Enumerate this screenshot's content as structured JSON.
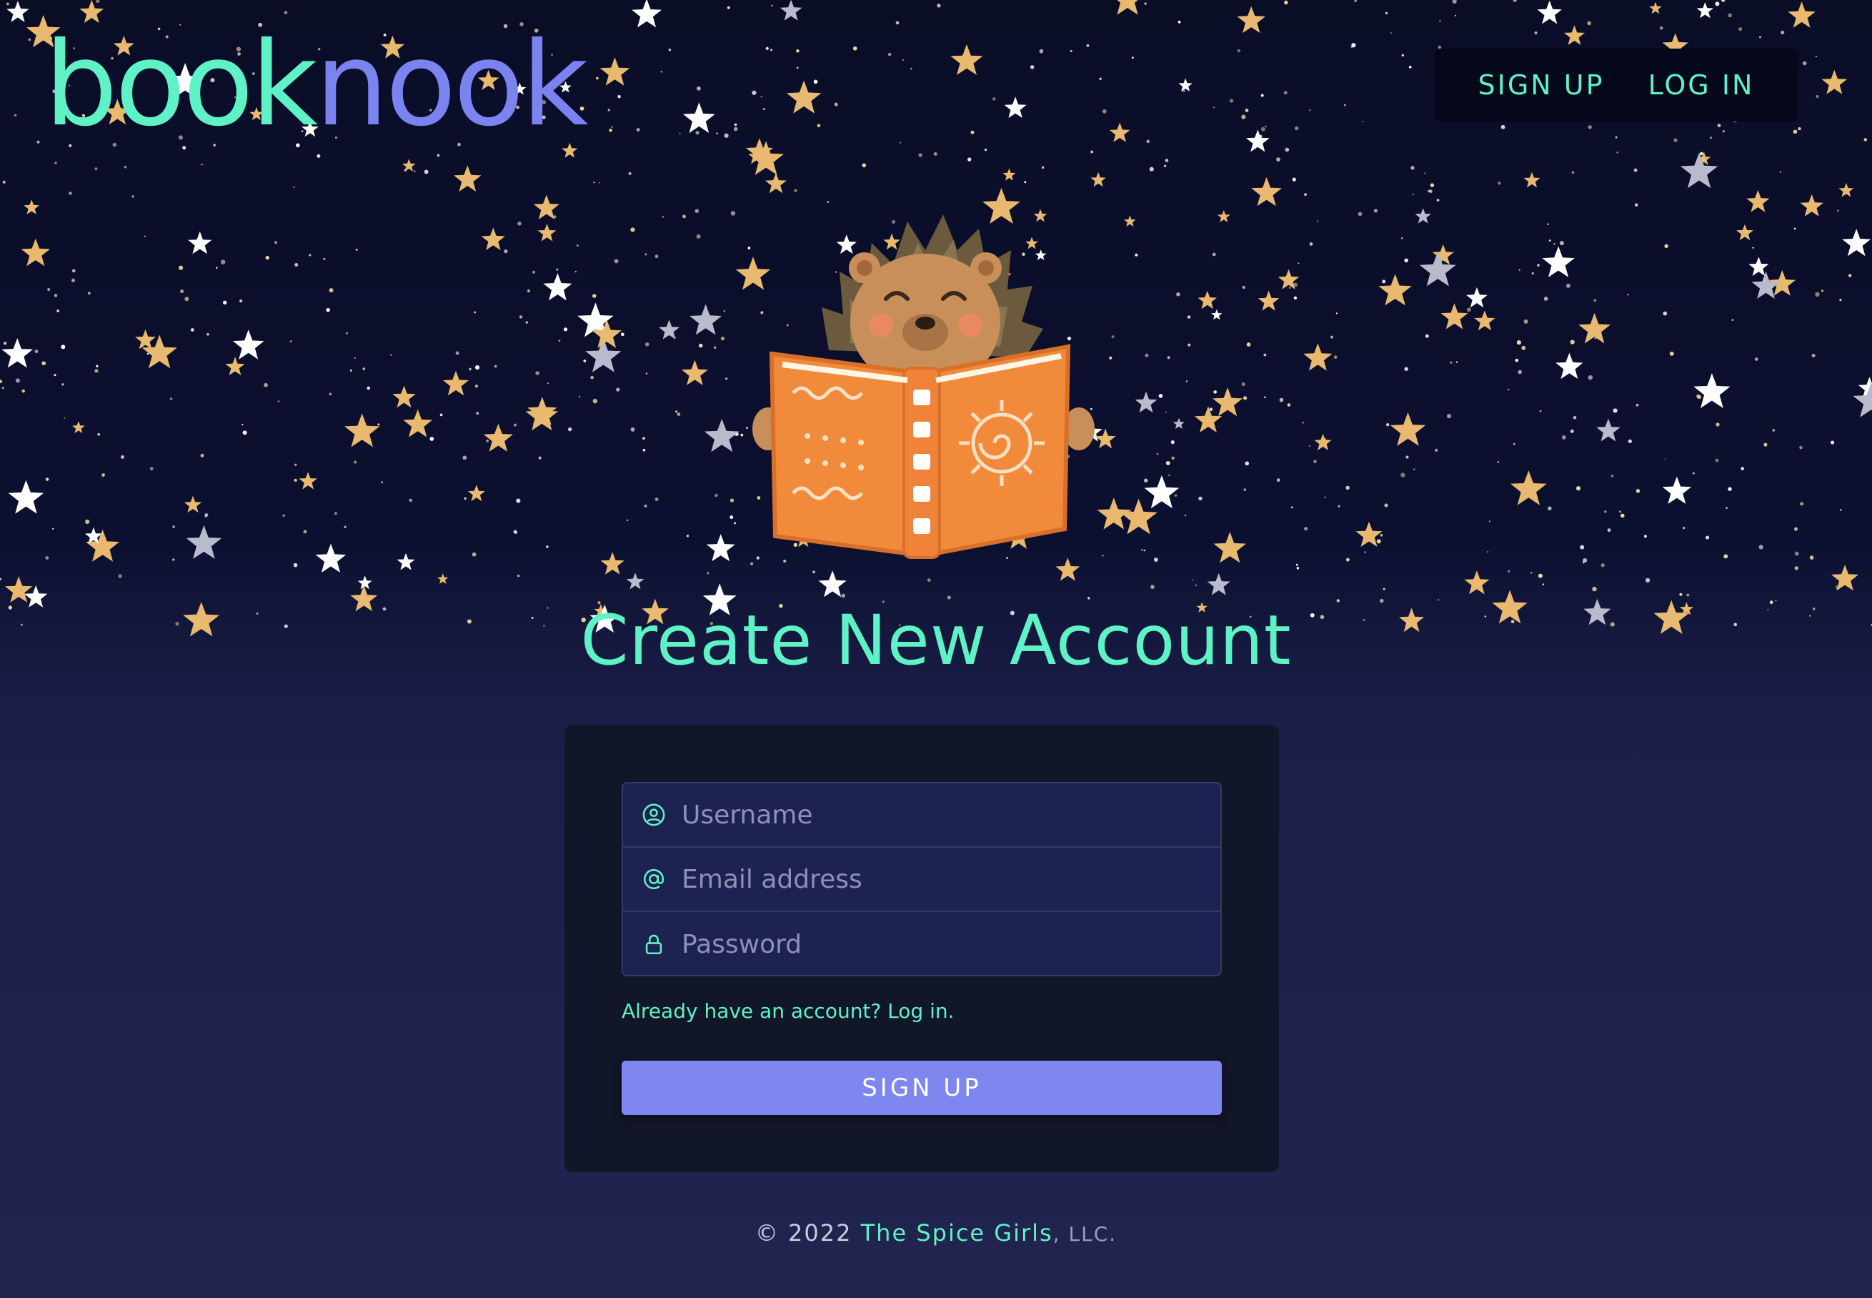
{
  "header": {
    "logo_part1": "book",
    "logo_part2": "nook",
    "nav": {
      "signup_label": "SIGN UP",
      "login_label": "LOG IN"
    }
  },
  "main": {
    "title": "Create New Account",
    "form": {
      "username_placeholder": "Username",
      "email_placeholder": "Email address",
      "password_placeholder": "Password",
      "username_value": "",
      "email_value": "",
      "password_value": "",
      "login_link": "Already have an account? Log in.",
      "submit_label": "SIGN UP"
    }
  },
  "footer": {
    "copyright": "© 2022",
    "brand": "The Spice Girls",
    "suffix": ", LLC."
  },
  "icons": {
    "user": "user-circle-icon",
    "email": "at-sign-icon",
    "password": "lock-icon"
  },
  "colors": {
    "accent": "#5ef2c6",
    "brand_secondary": "#7b83f0",
    "button": "#7e86f0",
    "background": "#0c1030",
    "card": "#111629"
  }
}
